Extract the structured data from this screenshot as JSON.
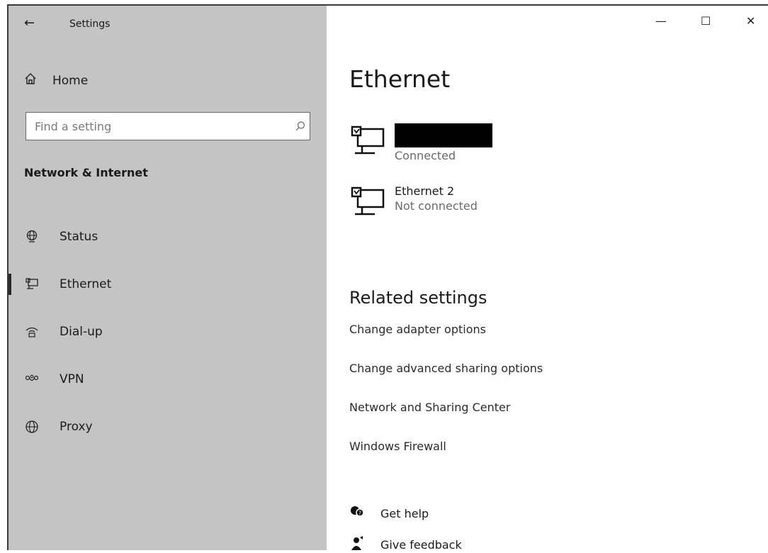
{
  "window": {
    "title": "Settings"
  },
  "sidebar": {
    "back_glyph": "←",
    "home_label": "Home",
    "search_placeholder": "Find a setting",
    "section_title": "Network & Internet",
    "items": [
      {
        "label": "Status",
        "icon": "globe-status-icon",
        "selected": false
      },
      {
        "label": "Ethernet",
        "icon": "ethernet-icon",
        "selected": true
      },
      {
        "label": "Dial-up",
        "icon": "dialup-icon",
        "selected": false
      },
      {
        "label": "VPN",
        "icon": "vpn-icon",
        "selected": false
      },
      {
        "label": "Proxy",
        "icon": "globe-icon",
        "selected": false
      }
    ]
  },
  "window_controls": {
    "minimize": "—",
    "maximize": "☐",
    "close": "✕"
  },
  "main": {
    "title": "Ethernet",
    "adapters": [
      {
        "name": "",
        "name_redacted": true,
        "status": "Connected"
      },
      {
        "name": "Ethernet 2",
        "name_redacted": false,
        "status": "Not connected"
      }
    ],
    "related_title": "Related settings",
    "related_links": [
      "Change adapter options",
      "Change advanced sharing options",
      "Network and Sharing Center",
      "Windows Firewall"
    ],
    "help": {
      "get_help": "Get help",
      "give_feedback": "Give feedback"
    }
  }
}
